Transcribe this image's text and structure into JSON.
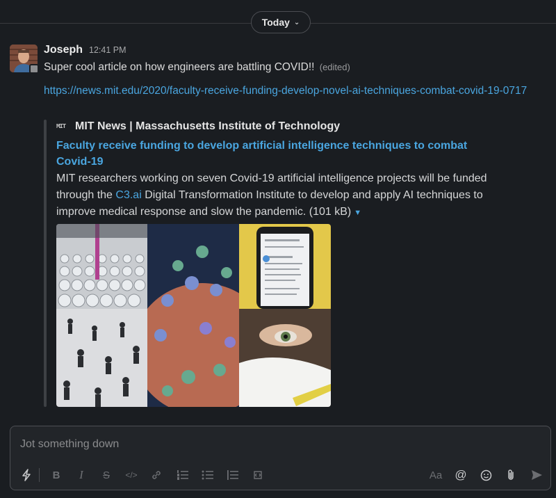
{
  "date_divider": {
    "label": "Today"
  },
  "message": {
    "author": "Joseph",
    "time": "12:41 PM",
    "text": "Super cool article on how engineers are battling COVID!!",
    "edited": "(edited)",
    "link": "https://news.mit.edu/2020/faculty-receive-funding-develop-novel-ai-techniques-combat-covid-19-0717"
  },
  "unfurl": {
    "site_logo": "MIT",
    "site_name": "MIT News | Massachusetts Institute of Technology",
    "title": "Faculty receive funding to develop artificial intelligence techniques to combat Covid-19",
    "desc_before": "MIT researchers working on seven Covid-19 artificial intelligence projects will be funded through the ",
    "desc_link": "C3.ai",
    "desc_after": " Digital Transformation Institute to develop and apply AI techniques to improve medical response and slow the pandemic.",
    "size": "(101 kB)"
  },
  "composer": {
    "placeholder": "Jot something down",
    "toolbar": [
      "shortcuts-icon",
      "bold-icon",
      "italic-icon",
      "strikethrough-icon",
      "code-icon",
      "link-icon",
      "ordered-list-icon",
      "bulleted-list-icon",
      "blockquote-icon",
      "code-block-icon",
      "text-format-icon",
      "mention-icon",
      "emoji-icon",
      "attach-icon",
      "send-icon"
    ]
  }
}
